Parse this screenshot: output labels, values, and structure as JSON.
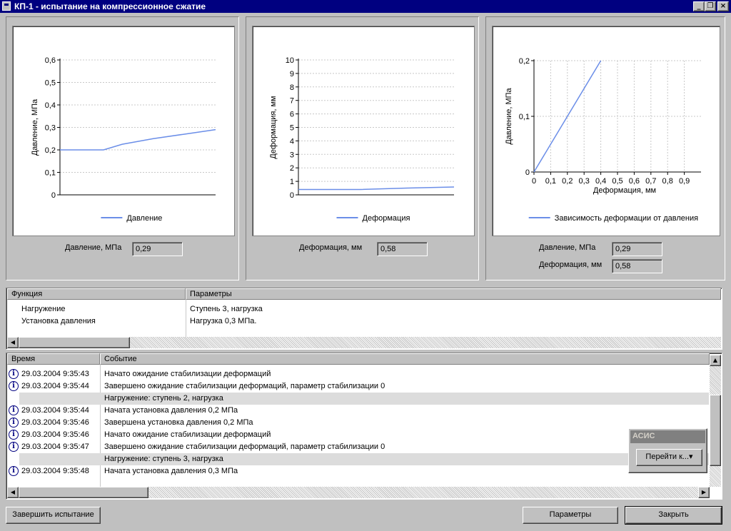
{
  "window": {
    "title": "КП-1 - испытание на компрессионное сжатие",
    "buttons": {
      "minimize": "_",
      "restore": "❐",
      "close": "×"
    }
  },
  "panels": {
    "pressure": {
      "value_label": "Давление, МПа",
      "value": "0,29"
    },
    "deformation": {
      "value_label": "Деформация, мм",
      "value": "0,58"
    },
    "dependency": {
      "pressure_label": "Давление, МПа",
      "pressure_value": "0,29",
      "deformation_label": "Деформация, мм",
      "deformation_value": "0,58"
    }
  },
  "chart_data": [
    {
      "type": "line",
      "title": "",
      "xlabel": "",
      "ylabel": "Давление, МПа",
      "y_ticks": [
        "0",
        "0,1",
        "0,2",
        "0,3",
        "0,4",
        "0,5",
        "0,6"
      ],
      "ylim": [
        0,
        0.6
      ],
      "xlim": [
        0,
        1
      ],
      "grid": true,
      "legend_position": "bottom",
      "series": [
        {
          "name": "Давление",
          "color": "#6b8ee8",
          "x": [
            0,
            0.28,
            0.4,
            0.6,
            0.8,
            1.0
          ],
          "y": [
            0.2,
            0.2,
            0.225,
            0.25,
            0.27,
            0.29
          ]
        }
      ]
    },
    {
      "type": "line",
      "title": "",
      "xlabel": "",
      "ylabel": "Деформация, мм",
      "y_ticks": [
        "0",
        "1",
        "2",
        "3",
        "4",
        "5",
        "6",
        "7",
        "8",
        "9",
        "10"
      ],
      "ylim": [
        0,
        10
      ],
      "xlim": [
        0,
        1
      ],
      "grid": true,
      "legend_position": "bottom",
      "series": [
        {
          "name": "Деформация",
          "color": "#6b8ee8",
          "x": [
            0,
            0.4,
            0.7,
            1.0
          ],
          "y": [
            0.4,
            0.4,
            0.5,
            0.58
          ]
        }
      ]
    },
    {
      "type": "line",
      "title": "",
      "xlabel": "Деформация, мм",
      "ylabel": "Давление, МПа",
      "x_ticks": [
        "0",
        "0,1",
        "0,2",
        "0,3",
        "0,4",
        "0,5",
        "0,6",
        "0,7",
        "0,8",
        "0,9"
      ],
      "y_ticks": [
        "0",
        "0,1",
        "0,2"
      ],
      "xlim": [
        0,
        1
      ],
      "ylim": [
        0,
        0.2
      ],
      "grid": true,
      "legend_position": "bottom",
      "series": [
        {
          "name": "Зависимость деформации от давления",
          "color": "#6b8ee8",
          "x": [
            0,
            0.4
          ],
          "y": [
            0,
            0.2
          ]
        }
      ]
    }
  ],
  "functions_table": {
    "headers": [
      "Функция",
      "Параметры"
    ],
    "rows": [
      {
        "function": "Нагружение",
        "params": "Ступень 3, нагрузка"
      },
      {
        "function": "Установка давления",
        "params": "Нагрузка 0,3 МПа."
      }
    ]
  },
  "events_table": {
    "headers": [
      "Время",
      "Событие"
    ],
    "rows": [
      {
        "time": "29.03.2004 9:35:43",
        "event": "Начато ожидание стабилизации деформаций",
        "icon": "info-icon",
        "group": false
      },
      {
        "time": "29.03.2004 9:35:44",
        "event": "Завершено ожидание стабилизации деформаций, параметр стабилизации 0",
        "icon": "info-icon",
        "group": false
      },
      {
        "time": "",
        "event": "Нагружение: ступень 2, нагрузка",
        "icon": "",
        "group": true
      },
      {
        "time": "29.03.2004 9:35:44",
        "event": "Начата установка давления 0,2 МПа",
        "icon": "info-icon",
        "group": false
      },
      {
        "time": "29.03.2004 9:35:46",
        "event": "Завершена установка давления 0,2 МПа",
        "icon": "info-icon",
        "group": false
      },
      {
        "time": "29.03.2004 9:35:46",
        "event": "Начато ожидание стабилизации деформаций",
        "icon": "info-icon",
        "group": false
      },
      {
        "time": "29.03.2004 9:35:47",
        "event": "Завершено ожидание стабилизации деформаций, параметр стабилизации 0",
        "icon": "info-icon",
        "group": false
      },
      {
        "time": "",
        "event": "Нагружение: ступень 3, нагрузка",
        "icon": "",
        "group": true
      },
      {
        "time": "29.03.2004 9:35:48",
        "event": "Начата установка давления 0,3 МПа",
        "icon": "info-icon",
        "group": false
      }
    ]
  },
  "popup": {
    "title": "АСИС",
    "button": "Перейти к...▾"
  },
  "footer": {
    "finish": "Завершить испытание",
    "params": "Параметры",
    "close": "Закрыть"
  }
}
